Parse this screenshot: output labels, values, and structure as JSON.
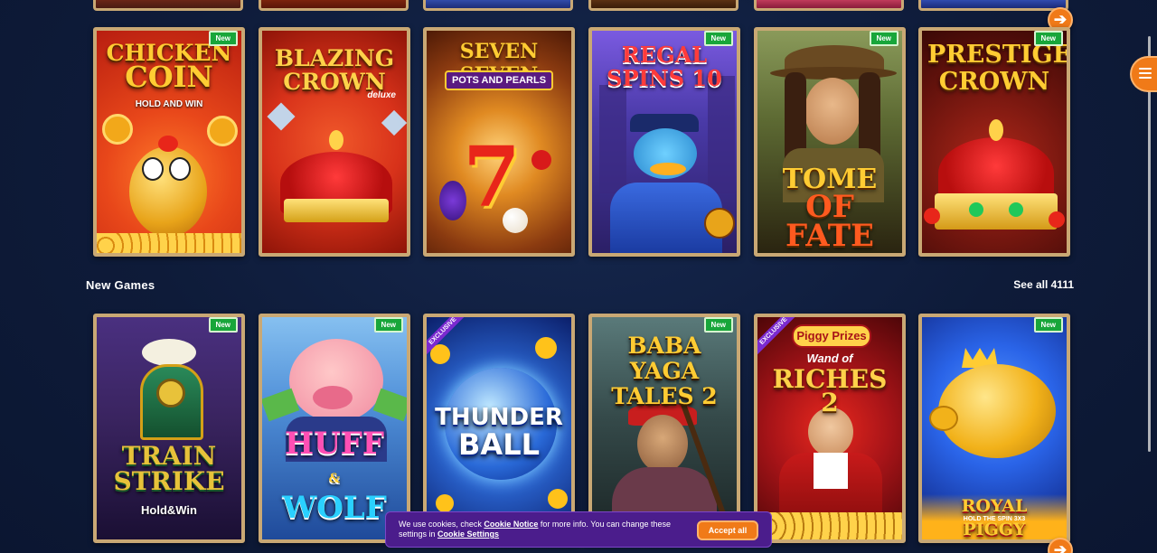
{
  "row1_games": [
    {
      "title_line1": "CHICKEN",
      "title_line2": "COIN",
      "subtitle": "HOLD AND WIN",
      "is_new": true,
      "bg": [
        "#e8471a",
        "#b81e10"
      ],
      "accent": "#ffcc33"
    },
    {
      "title_line1": "BLAZING",
      "title_line2": "CROWN",
      "subtitle": "deluxe",
      "is_new": false,
      "bg": [
        "#d8321a",
        "#8e1408"
      ],
      "accent": "#ffd24a"
    },
    {
      "title_line1": "SEVEN SEVEN",
      "title_line2": "",
      "subtitle": "POTS AND PEARLS",
      "is_new": false,
      "bg": [
        "#c56a18",
        "#6e2b08"
      ],
      "accent": "#ffd66b"
    },
    {
      "title_line1": "REGAL",
      "title_line2": "SPINS 10",
      "subtitle": "",
      "is_new": true,
      "bg": [
        "#5b3fb6",
        "#2b1f66"
      ],
      "accent": "#ff3b3b"
    },
    {
      "title_line1": "TOME",
      "title_line2": "OF FATE",
      "subtitle": "",
      "is_new": true,
      "bg": [
        "#5d6a33",
        "#2a2410"
      ],
      "accent": "#ff5a1f"
    },
    {
      "title_line1": "PRESTIGE",
      "title_line2": "CROWN",
      "subtitle": "",
      "is_new": true,
      "bg": [
        "#7a1810",
        "#3a0806"
      ],
      "accent": "#ffcc33"
    }
  ],
  "section": {
    "title": "New Games",
    "see_all": "See all 4111"
  },
  "row2_games": [
    {
      "title_line1": "TRAIN",
      "title_line2": "STRIKE",
      "subtitle": "Hold&Win",
      "is_new": true,
      "exclusive": false,
      "bg": [
        "#3a2460",
        "#1a0f33"
      ],
      "accent": "#e7c23a"
    },
    {
      "title_line1": "HUFF",
      "title_line2": "WOLF",
      "subtitle": "&",
      "is_new": true,
      "exclusive": false,
      "bg": [
        "#4f8fd8",
        "#1f4a9a"
      ],
      "accent": "#ff4fb4"
    },
    {
      "title_line1": "THUNDER",
      "title_line2": "BALL",
      "subtitle": "",
      "is_new": false,
      "exclusive": true,
      "bg": [
        "#2f6fe0",
        "#0b1f6a"
      ],
      "accent": "#ffffff"
    },
    {
      "title_line1": "BABA YAGA",
      "title_line2": "TALES 2",
      "subtitle": "",
      "is_new": true,
      "exclusive": false,
      "bg": [
        "#354a4a",
        "#1a2424"
      ],
      "accent": "#ffcc33"
    },
    {
      "title_line1": "Piggy Prizes",
      "title_line2": "RICHES 2",
      "subtitle": "Wand of",
      "is_new": false,
      "exclusive": true,
      "bg": [
        "#a81418",
        "#4e0608"
      ],
      "accent": "#ffd24a"
    },
    {
      "title_line1": "ROYAL PIGGY",
      "title_line2": "",
      "subtitle": "HOLD THE SPIN 3X3",
      "is_new": true,
      "exclusive": false,
      "bg": [
        "#2a64e8",
        "#0c1e78"
      ],
      "accent": "#ffcc33"
    }
  ],
  "labels": {
    "new": "New",
    "exclusive": "EXCLUSIVE"
  },
  "cookie": {
    "text_1": "We use cookies, check ",
    "link_notice": "Cookie Notice",
    "text_2": " for more info. You can change these settings in ",
    "link_settings": "Cookie Settings",
    "accept": "Accept all"
  },
  "colors": {
    "accent_orange": "#f07a18",
    "new_badge": "#18a63a",
    "frame_gold": "#c9a874",
    "cookie_bg": "#4b1d8c"
  },
  "icons": {
    "next_arrow": "arrow-right-icon",
    "menu": "hamburger-menu-icon"
  }
}
